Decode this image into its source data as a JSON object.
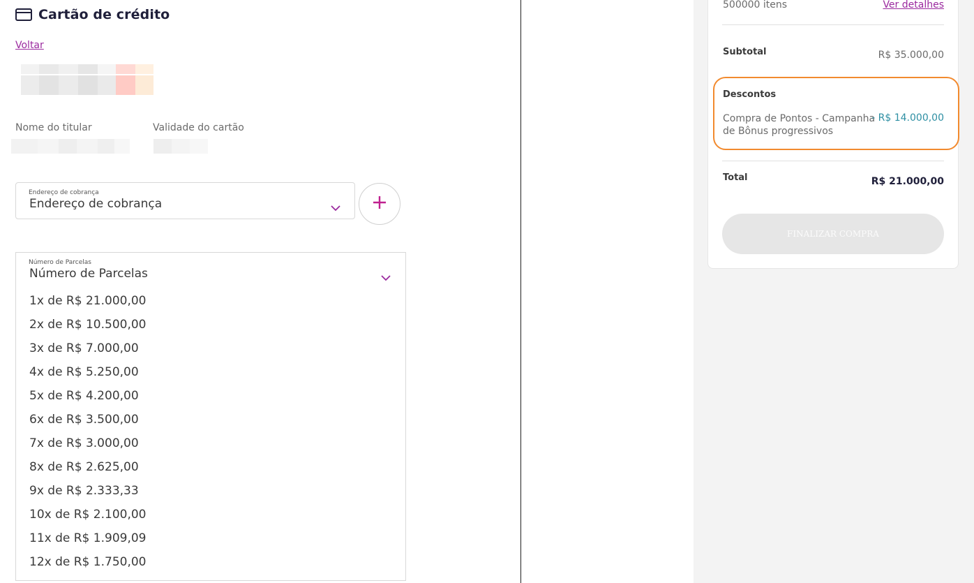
{
  "header": {
    "title": "Cartão de crédito",
    "icon": "credit-card-icon"
  },
  "back_link": "Voltar",
  "fields": {
    "holder_label": "Nome do titular",
    "validity_label": "Validade do cartão"
  },
  "billing": {
    "mini_label": "Endereço de cobrança",
    "value": "Endereço de cobrança",
    "add_icon": "plus-icon"
  },
  "installments": {
    "mini_label": "Número de Parcelas",
    "value": "Número de Parcelas",
    "options": [
      "1x de R$ 21.000,00",
      "2x de R$ 10.500,00",
      "3x de R$ 7.000,00",
      "4x de R$ 5.250,00",
      "5x de R$ 4.200,00",
      "6x de R$ 3.500,00",
      "7x de R$ 3.000,00",
      "8x de R$ 2.625,00",
      "9x de R$ 2.333,33",
      "10x de R$ 2.100,00",
      "11x de R$ 1.909,09",
      "12x de R$ 1.750,00"
    ]
  },
  "summary": {
    "items_count": "500000 itens",
    "details_link": "Ver detalhes",
    "subtotal_label": "Subtotal",
    "subtotal_value": "R$ 35.000,00",
    "discounts_label": "Descontos",
    "discount_desc_line1": "Compra de Pontos - Campanha",
    "discount_desc_line2": "de Bônus progressivos",
    "discount_value": "- R$ 14.000,00",
    "total_label": "Total",
    "total_value": "R$ 21.000,00",
    "finalize_label": "FINALIZAR COMPRA"
  },
  "colors": {
    "accent": "#9b2a9f",
    "highlight": "#f28a2e",
    "discount": "#2e8fa3"
  }
}
